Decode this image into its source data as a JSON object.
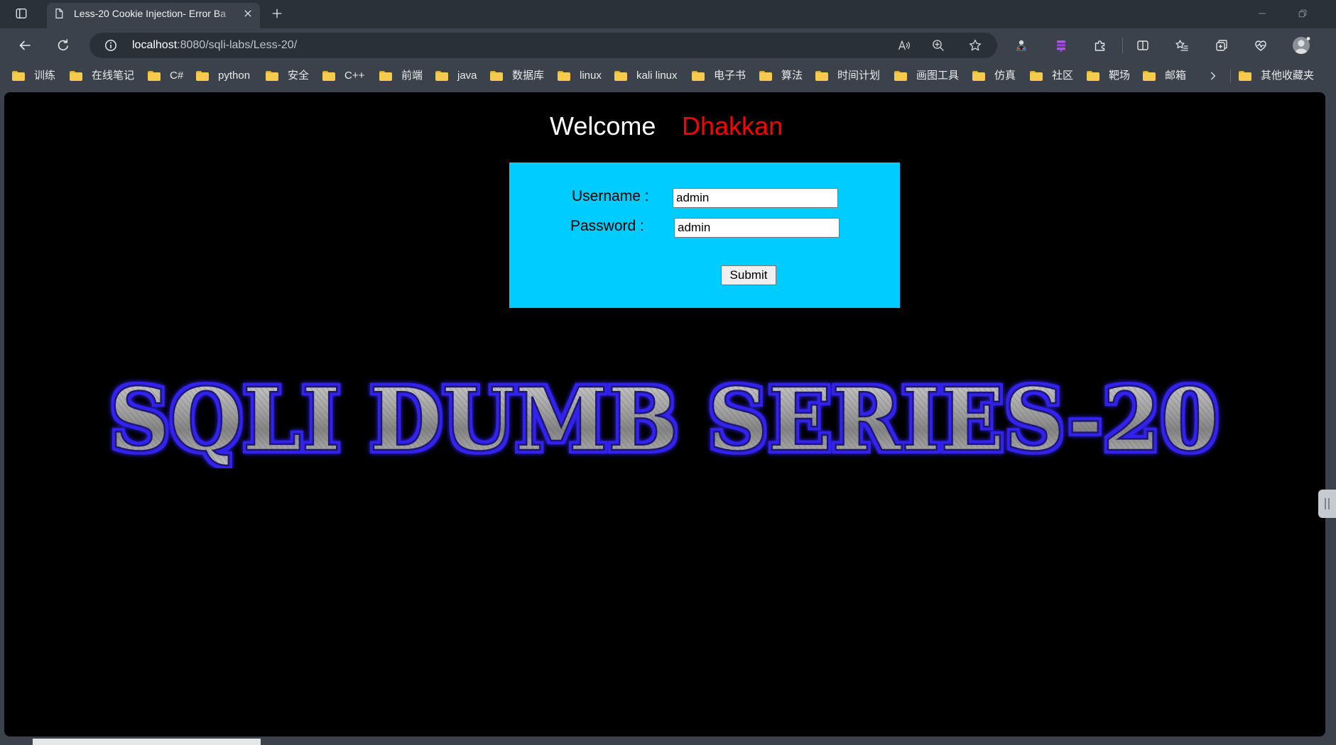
{
  "window": {
    "tab": {
      "title": "Less-20 Cookie Injection- Error Ba",
      "icon": "page-icon"
    },
    "icons": [
      "workspaces-icon",
      "close-icon",
      "plus-icon",
      "minimize-icon",
      "restore-icon"
    ]
  },
  "toolbar": {
    "url": {
      "host": "localhost",
      "path": ":8080/sqli-labs/Less-20/"
    },
    "icons": [
      "back-arrow-icon",
      "refresh-icon",
      "site-info-icon",
      "read-aloud-icon",
      "zoom-icon",
      "star-icon",
      "extension-figure-icon",
      "extension-purple-icon",
      "puzzle-icon",
      "split-screen-icon",
      "favorites-icon",
      "collections-icon",
      "browser-essentials-icon",
      "profile-avatar-icon"
    ]
  },
  "bookmarks": {
    "items": [
      "训练",
      "在线笔记",
      "C#",
      "python",
      "安全",
      "C++",
      "前端",
      "java",
      "数据库",
      "linux",
      "kali linux",
      "电子书",
      "算法",
      "时间计划",
      "画图工具",
      "仿真",
      "社区",
      "靶场",
      "邮箱"
    ],
    "other": "其他收藏夹"
  },
  "page": {
    "welcome": "Welcome",
    "user": "Dhakkan",
    "form": {
      "username_label": "Username :",
      "username_value": "admin",
      "password_label": "Password :",
      "password_value": "admin",
      "submit_label": "Submit"
    },
    "banner": "SQLI DUMB SERIES-20"
  },
  "colors": {
    "page_background": "#000000",
    "welcome_text": "#ffffff",
    "user_text": "#ff0000",
    "form_background": "#00ccff",
    "banner_glow": "#3322ee",
    "folder": "#f6c94f"
  }
}
